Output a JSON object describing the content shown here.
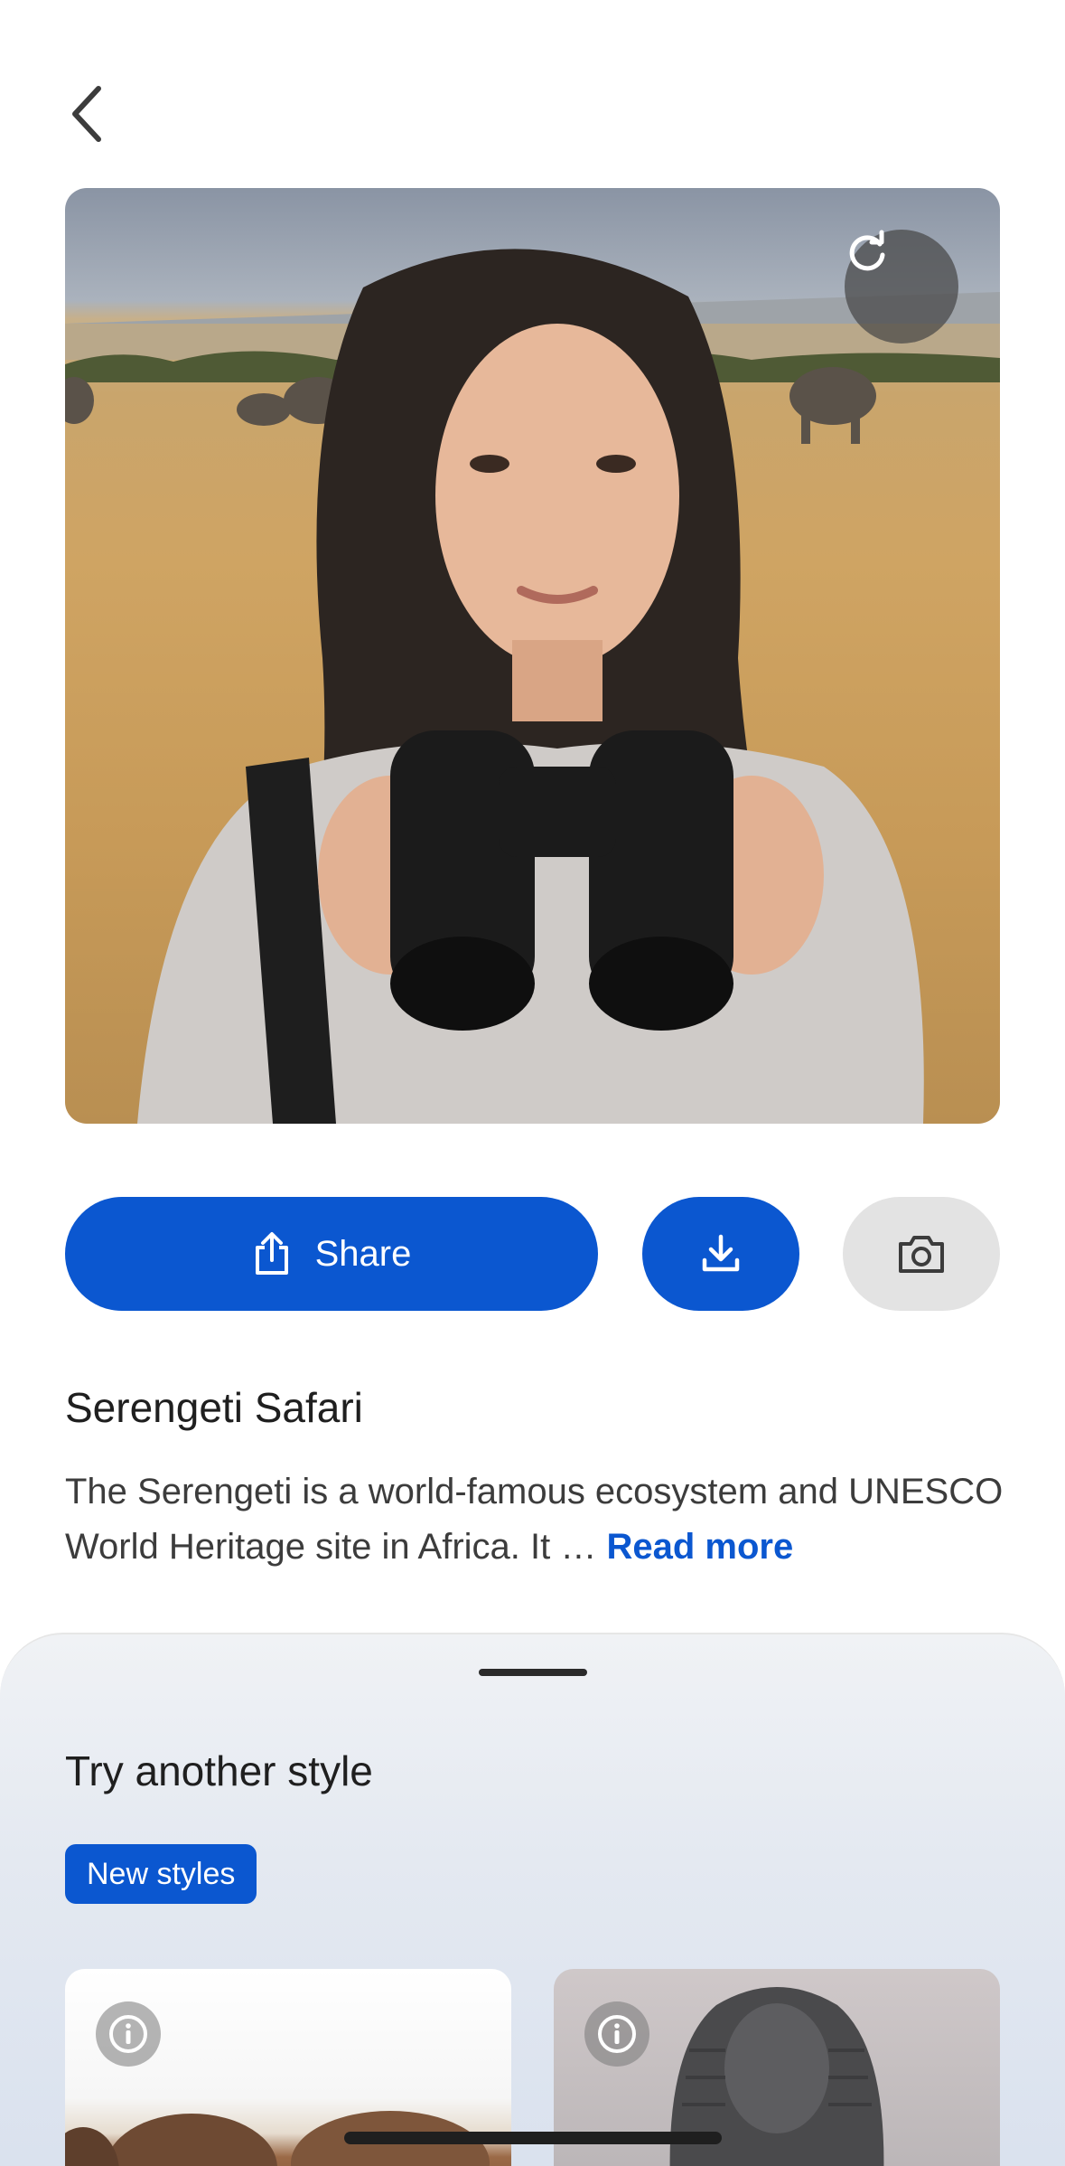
{
  "nav": {
    "back_icon": "chevron-left-icon"
  },
  "hero": {
    "regenerate_icon": "refresh-icon"
  },
  "actions": {
    "share_label": "Share",
    "share_icon": "share-icon",
    "download_icon": "download-icon",
    "camera_icon": "camera-icon"
  },
  "style": {
    "title": "Serengeti Safari",
    "description": "The Serengeti is a world-famous ecosystem and UNESCO World Heritage site in Africa. It … ",
    "read_more": "Read more"
  },
  "sheet": {
    "title": "Try another style",
    "badge": "New styles",
    "cards": [
      {
        "info_icon": "info-icon"
      },
      {
        "info_icon": "info-icon"
      }
    ]
  },
  "colors": {
    "accent": "#0b57d0",
    "secondary_button": "#e3e3e3"
  }
}
